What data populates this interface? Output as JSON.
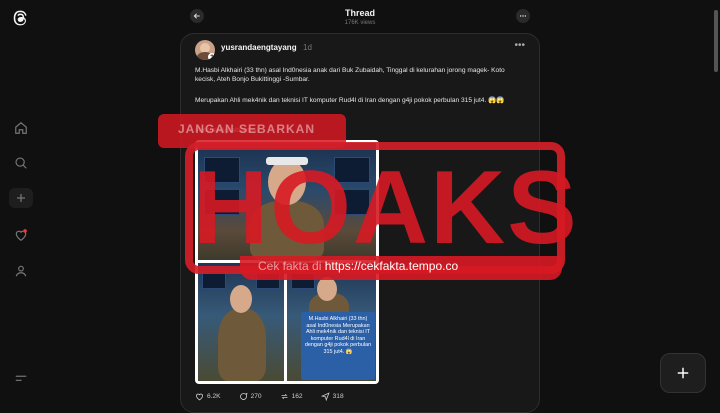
{
  "header": {
    "title": "Thread",
    "views": "176K views"
  },
  "post": {
    "username": "yusrandaengtayang",
    "age": "1d",
    "paragraph1": "M.Hasbi Alkhairi (33 thn) asal Ind0nesia anak dari Buk Zubaidah, Tinggal di kelurahan jorong magek- Koto kecisk, Ateh Bonjo Bukittinggi -Sumbar.",
    "paragraph2": "Merupakan Ahli mek4nik dan teknisi IT komputer Rud4l di Iran dengan g4ji pokok perbulan 315 jut4. 😱😱",
    "paragraph3": "#fotoberdigitalbantuai",
    "image_caption": "M.Hasbi Alkhairi (33 thn) asal Ind0nesia Merupakan Ahli mek4nik dan teknisi IT komputer Rud4l di Iran dengan g4ji pokok perbulan 315 jut4. 😱",
    "likes": "6.2K",
    "comments": "270",
    "reposts": "162",
    "shares": "318"
  },
  "overlay": {
    "stamp": "HOAKS",
    "ribbon": "JANGAN SEBARKAN",
    "url_prefix": "Cek fakta di",
    "url": "https://cekfakta.tempo.co"
  },
  "colors": {
    "background": "#101010",
    "card": "#181818",
    "stamp_red": "#d71923"
  },
  "icons": [
    "threads-logo-icon",
    "home-icon",
    "search-icon",
    "create-icon",
    "heart-icon",
    "profile-icon",
    "menu-icon",
    "back-arrow-icon",
    "more-icon",
    "plus-icon"
  ]
}
